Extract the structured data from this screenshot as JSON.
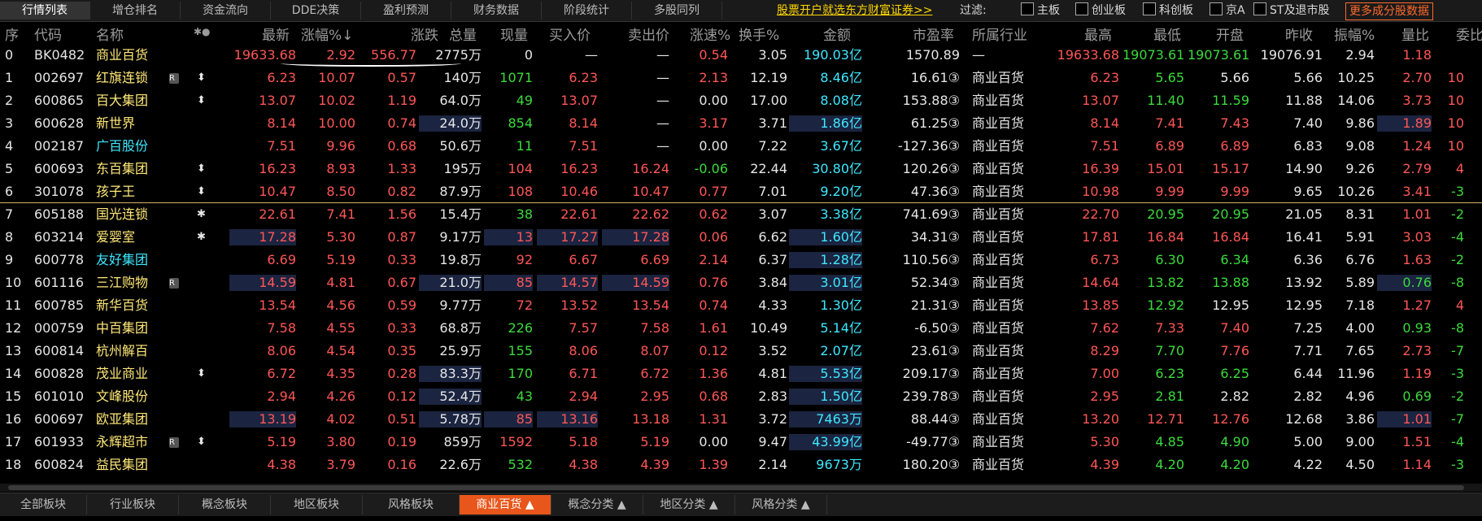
{
  "top_tabs": [
    "行情列表",
    "增仓排名",
    "资金流向",
    "DDE决策",
    "盈利预测",
    "财务数据",
    "阶段统计",
    "多股同列"
  ],
  "promo": "股票开户就选东方财富证券>>",
  "filter": {
    "label": "过滤:",
    "options": [
      "主板",
      "创业板",
      "科创板",
      "京A",
      "ST及退市股"
    ],
    "more": "更多成分股数据"
  },
  "headers": {
    "seq": "序",
    "code": "代码",
    "name": "名称",
    "star": "✱●",
    "last": "最新",
    "chgpct": "涨幅%↓",
    "chg": "涨跌",
    "vol": "总量",
    "curvol": "现量",
    "bid": "买入价",
    "ask": "卖出价",
    "speed": "涨速%",
    "turn": "换手%",
    "amount": "金额",
    "pe": "市盈率",
    "industry": "所属行业",
    "high": "最高",
    "low": "最低",
    "open": "开盘",
    "prev": "昨收",
    "amp": "振幅%",
    "vr": "量比",
    "wb": "委比"
  },
  "rows": [
    {
      "seq": "0",
      "code": "BK0482",
      "name": "商业百货",
      "badge": "",
      "mark": "",
      "last": "19633.68",
      "chgpct": "2.92",
      "chg": "556.77",
      "vol": "2775万",
      "curvol": "0",
      "bid": "—",
      "ask": "—",
      "speed": "0.54",
      "turn": "3.05",
      "amount": "190.03亿",
      "pe": "1570.89",
      "industry": "—",
      "high": "19633.68",
      "low": "19073.61",
      "open": "19073.61",
      "prev": "19076.91",
      "amp": "2.94",
      "vr": "1.18",
      "wb": ""
    },
    {
      "seq": "1",
      "code": "002697",
      "name": "红旗连锁",
      "badge": "R",
      "mark": "⬍",
      "last": "6.23",
      "chgpct": "10.07",
      "chg": "0.57",
      "vol": "140万",
      "curvol": "1071",
      "bid": "6.23",
      "ask": "—",
      "speed": "2.13",
      "turn": "12.19",
      "amount": "8.46亿",
      "pe": "16.61③",
      "industry": "商业百货",
      "high": "6.23",
      "low": "5.65",
      "open": "5.66",
      "prev": "5.66",
      "amp": "10.25",
      "vr": "2.70",
      "wb": "10"
    },
    {
      "seq": "2",
      "code": "600865",
      "name": "百大集团",
      "badge": "",
      "mark": "⬍",
      "last": "13.07",
      "chgpct": "10.02",
      "chg": "1.19",
      "vol": "64.0万",
      "curvol": "49",
      "bid": "13.07",
      "ask": "—",
      "speed": "0.00",
      "turn": "17.00",
      "amount": "8.08亿",
      "pe": "153.88③",
      "industry": "商业百货",
      "high": "13.07",
      "low": "11.40",
      "open": "11.59",
      "prev": "11.88",
      "amp": "14.06",
      "vr": "3.73",
      "wb": "10"
    },
    {
      "seq": "3",
      "code": "600628",
      "name": "新世界",
      "badge": "",
      "mark": "",
      "last": "8.14",
      "chgpct": "10.00",
      "chg": "0.74",
      "vol": "24.0万",
      "curvol": "854",
      "bid": "8.14",
      "ask": "—",
      "speed": "3.17",
      "turn": "3.71",
      "amount": "1.86亿",
      "pe": "61.25③",
      "industry": "商业百货",
      "high": "8.14",
      "low": "7.41",
      "open": "7.43",
      "prev": "7.40",
      "amp": "9.86",
      "vr": "1.89",
      "wb": "10"
    },
    {
      "seq": "4",
      "code": "002187",
      "name": "广百股份",
      "badge": "",
      "mark": "",
      "last": "7.51",
      "chgpct": "9.96",
      "chg": "0.68",
      "vol": "50.6万",
      "curvol": "11",
      "bid": "7.51",
      "ask": "—",
      "speed": "0.00",
      "turn": "7.22",
      "amount": "3.67亿",
      "pe": "-127.36③",
      "industry": "商业百货",
      "high": "7.51",
      "low": "6.89",
      "open": "6.89",
      "prev": "6.83",
      "amp": "9.08",
      "vr": "1.24",
      "wb": "10"
    },
    {
      "seq": "5",
      "code": "600693",
      "name": "东百集团",
      "badge": "",
      "mark": "⬍",
      "last": "16.23",
      "chgpct": "8.93",
      "chg": "1.33",
      "vol": "195万",
      "curvol": "104",
      "bid": "16.23",
      "ask": "16.24",
      "speed": "-0.06",
      "turn": "22.44",
      "amount": "30.80亿",
      "pe": "120.26③",
      "industry": "商业百货",
      "high": "16.39",
      "low": "15.01",
      "open": "15.17",
      "prev": "14.90",
      "amp": "9.26",
      "vr": "2.79",
      "wb": "4"
    },
    {
      "seq": "6",
      "code": "301078",
      "name": "孩子王",
      "badge": "",
      "mark": "⬍",
      "last": "10.47",
      "chgpct": "8.50",
      "chg": "0.82",
      "vol": "87.9万",
      "curvol": "108",
      "bid": "10.46",
      "ask": "10.47",
      "speed": "0.77",
      "turn": "7.01",
      "amount": "9.20亿",
      "pe": "47.36③",
      "industry": "商业百货",
      "high": "10.98",
      "low": "9.99",
      "open": "9.99",
      "prev": "9.65",
      "amp": "10.26",
      "vr": "3.41",
      "wb": "-3"
    },
    {
      "seq": "7",
      "code": "605188",
      "name": "国光连锁",
      "badge": "",
      "mark": "✱",
      "last": "22.61",
      "chgpct": "7.41",
      "chg": "1.56",
      "vol": "15.4万",
      "curvol": "38",
      "bid": "22.61",
      "ask": "22.62",
      "speed": "0.62",
      "turn": "3.07",
      "amount": "3.38亿",
      "pe": "741.69③",
      "industry": "商业百货",
      "high": "22.70",
      "low": "20.95",
      "open": "20.95",
      "prev": "21.05",
      "amp": "8.31",
      "vr": "1.01",
      "wb": "-2"
    },
    {
      "seq": "8",
      "code": "603214",
      "name": "爱婴室",
      "badge": "",
      "mark": "✱",
      "last": "17.28",
      "chgpct": "5.30",
      "chg": "0.87",
      "vol": "9.17万",
      "curvol": "13",
      "bid": "17.27",
      "ask": "17.28",
      "speed": "0.06",
      "turn": "6.62",
      "amount": "1.60亿",
      "pe": "34.31③",
      "industry": "商业百货",
      "high": "17.81",
      "low": "16.84",
      "open": "16.84",
      "prev": "16.41",
      "amp": "5.91",
      "vr": "3.03",
      "wb": "-4"
    },
    {
      "seq": "9",
      "code": "600778",
      "name": "友好集团",
      "badge": "",
      "mark": "",
      "last": "6.69",
      "chgpct": "5.19",
      "chg": "0.33",
      "vol": "19.8万",
      "curvol": "92",
      "bid": "6.67",
      "ask": "6.69",
      "speed": "2.14",
      "turn": "6.37",
      "amount": "1.28亿",
      "pe": "110.56③",
      "industry": "商业百货",
      "high": "6.73",
      "low": "6.30",
      "open": "6.34",
      "prev": "6.36",
      "amp": "6.76",
      "vr": "1.63",
      "wb": "-2"
    },
    {
      "seq": "10",
      "code": "601116",
      "name": "三江购物",
      "badge": "R",
      "mark": "",
      "last": "14.59",
      "chgpct": "4.81",
      "chg": "0.67",
      "vol": "21.0万",
      "curvol": "85",
      "bid": "14.57",
      "ask": "14.59",
      "speed": "0.76",
      "turn": "3.84",
      "amount": "3.01亿",
      "pe": "52.34③",
      "industry": "商业百货",
      "high": "14.64",
      "low": "13.82",
      "open": "13.88",
      "prev": "13.92",
      "amp": "5.89",
      "vr": "0.76",
      "wb": "-8"
    },
    {
      "seq": "11",
      "code": "600785",
      "name": "新华百货",
      "badge": "",
      "mark": "",
      "last": "13.54",
      "chgpct": "4.56",
      "chg": "0.59",
      "vol": "9.77万",
      "curvol": "72",
      "bid": "13.52",
      "ask": "13.54",
      "speed": "0.74",
      "turn": "4.33",
      "amount": "1.30亿",
      "pe": "21.31③",
      "industry": "商业百货",
      "high": "13.85",
      "low": "12.92",
      "open": "12.95",
      "prev": "12.95",
      "amp": "7.18",
      "vr": "1.27",
      "wb": "4"
    },
    {
      "seq": "12",
      "code": "000759",
      "name": "中百集团",
      "badge": "",
      "mark": "",
      "last": "7.58",
      "chgpct": "4.55",
      "chg": "0.33",
      "vol": "68.8万",
      "curvol": "226",
      "bid": "7.57",
      "ask": "7.58",
      "speed": "1.61",
      "turn": "10.49",
      "amount": "5.14亿",
      "pe": "-6.50③",
      "industry": "商业百货",
      "high": "7.62",
      "low": "7.33",
      "open": "7.40",
      "prev": "7.25",
      "amp": "4.00",
      "vr": "0.93",
      "wb": "-8"
    },
    {
      "seq": "13",
      "code": "600814",
      "name": "杭州解百",
      "badge": "",
      "mark": "",
      "last": "8.06",
      "chgpct": "4.54",
      "chg": "0.35",
      "vol": "25.9万",
      "curvol": "155",
      "bid": "8.06",
      "ask": "8.07",
      "speed": "0.12",
      "turn": "3.52",
      "amount": "2.07亿",
      "pe": "23.61③",
      "industry": "商业百货",
      "high": "8.29",
      "low": "7.70",
      "open": "7.76",
      "prev": "7.71",
      "amp": "7.65",
      "vr": "2.73",
      "wb": "-7"
    },
    {
      "seq": "14",
      "code": "600828",
      "name": "茂业商业",
      "badge": "",
      "mark": "⬍",
      "last": "6.72",
      "chgpct": "4.35",
      "chg": "0.28",
      "vol": "83.3万",
      "curvol": "170",
      "bid": "6.71",
      "ask": "6.72",
      "speed": "1.36",
      "turn": "4.81",
      "amount": "5.53亿",
      "pe": "209.17③",
      "industry": "商业百货",
      "high": "7.00",
      "low": "6.23",
      "open": "6.25",
      "prev": "6.44",
      "amp": "11.96",
      "vr": "1.19",
      "wb": "-3"
    },
    {
      "seq": "15",
      "code": "601010",
      "name": "文峰股份",
      "badge": "",
      "mark": "",
      "last": "2.94",
      "chgpct": "4.26",
      "chg": "0.12",
      "vol": "52.4万",
      "curvol": "43",
      "bid": "2.94",
      "ask": "2.95",
      "speed": "0.68",
      "turn": "2.83",
      "amount": "1.50亿",
      "pe": "239.78③",
      "industry": "商业百货",
      "high": "2.95",
      "low": "2.81",
      "open": "2.82",
      "prev": "2.82",
      "amp": "4.96",
      "vr": "0.69",
      "wb": "-2"
    },
    {
      "seq": "16",
      "code": "600697",
      "name": "欧亚集团",
      "badge": "",
      "mark": "",
      "last": "13.19",
      "chgpct": "4.02",
      "chg": "0.51",
      "vol": "5.78万",
      "curvol": "85",
      "bid": "13.16",
      "ask": "13.18",
      "speed": "1.31",
      "turn": "3.72",
      "amount": "7463万",
      "pe": "88.44③",
      "industry": "商业百货",
      "high": "13.20",
      "low": "12.71",
      "open": "12.76",
      "prev": "12.68",
      "amp": "3.86",
      "vr": "1.01",
      "wb": "-7"
    },
    {
      "seq": "17",
      "code": "601933",
      "name": "永辉超市",
      "badge": "R",
      "mark": "⬍",
      "last": "5.19",
      "chgpct": "3.80",
      "chg": "0.19",
      "vol": "859万",
      "curvol": "1592",
      "bid": "5.18",
      "ask": "5.19",
      "speed": "0.00",
      "turn": "9.47",
      "amount": "43.99亿",
      "pe": "-49.77③",
      "industry": "商业百货",
      "high": "5.30",
      "low": "4.85",
      "open": "4.90",
      "prev": "5.00",
      "amp": "9.00",
      "vr": "1.51",
      "wb": "-4"
    },
    {
      "seq": "18",
      "code": "600824",
      "name": "益民集团",
      "badge": "",
      "mark": "",
      "last": "4.38",
      "chgpct": "3.79",
      "chg": "0.16",
      "vol": "22.6万",
      "curvol": "532",
      "bid": "4.38",
      "ask": "4.39",
      "speed": "1.39",
      "turn": "2.14",
      "amount": "9673万",
      "pe": "180.20③",
      "industry": "商业百货",
      "high": "4.39",
      "low": "4.20",
      "open": "4.20",
      "prev": "4.22",
      "amp": "4.50",
      "vr": "1.14",
      "wb": "-3"
    }
  ],
  "bottom_tabs": [
    "全部板块",
    "行业板块",
    "概念板块",
    "地区板块",
    "风格板块",
    "商业百货 ▲",
    "概念分类 ▲",
    "地区分类 ▲",
    "风格分类 ▲"
  ],
  "colors": {
    "up": "#ff5656",
    "down": "#3bdb3b",
    "flat": "#e6e6e6",
    "amount": "#3ee8ff",
    "name": "#ffe877",
    "accent": "#e8561b"
  }
}
